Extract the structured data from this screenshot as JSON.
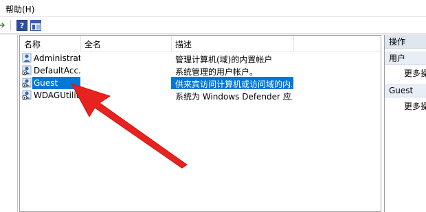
{
  "menubar": {
    "help_label": "帮助(H)"
  },
  "toolbar": {
    "forward_icon": "forward-arrow-icon",
    "help_icon_text": "?",
    "show_hide_panel_icon": "panel-icon"
  },
  "list": {
    "columns": [
      "名称",
      "全名",
      "描述"
    ],
    "rows": [
      {
        "name": "Administrat...",
        "full_name": "",
        "description": "管理计算机(域)的内置帐户"
      },
      {
        "name": "DefaultAcc...",
        "full_name": "",
        "description": "系统管理的用户帐户。"
      },
      {
        "name": "Guest",
        "full_name": "",
        "description": "供来宾访问计算机或访问域的内..."
      },
      {
        "name": "WDAGUtilit...",
        "full_name": "",
        "description": "系统为 Windows Defender 应用..."
      }
    ],
    "selected_index": 2
  },
  "actions": {
    "title": "操作",
    "sections": [
      {
        "header": "用户",
        "item": "更多操"
      },
      {
        "header": "Guest",
        "item": "更多操"
      }
    ]
  },
  "colors": {
    "selection": "#0078d7",
    "arrow": "#e8231f"
  }
}
